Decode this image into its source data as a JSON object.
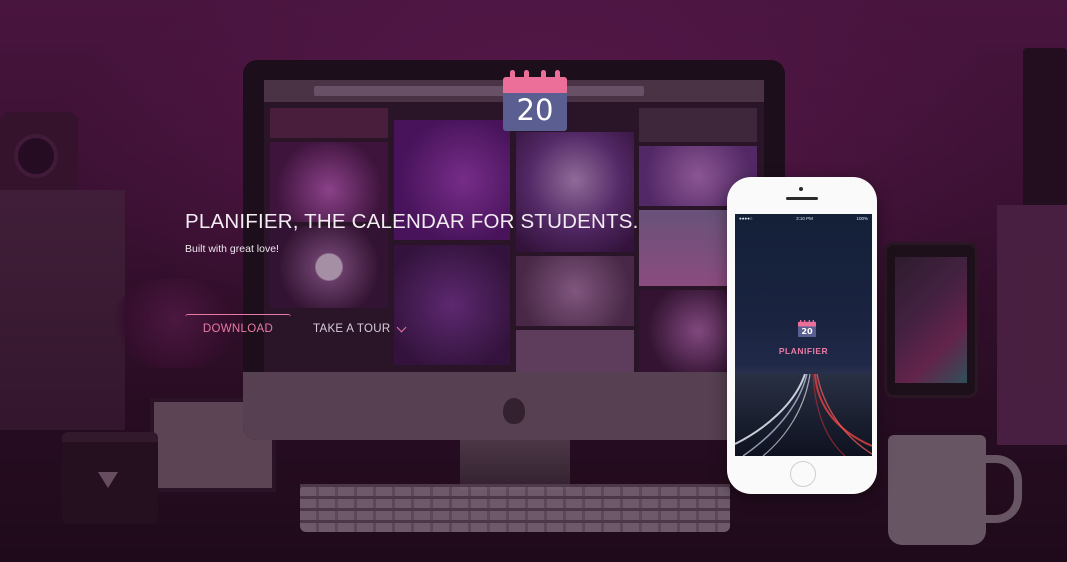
{
  "hero": {
    "title": "PLANIFIER, THE CALENDAR FOR STUDENTS.",
    "subtitle": "Built with great love!",
    "download_label": "DOWNLOAD",
    "tour_label": "TAKE A TOUR"
  },
  "logo": {
    "day": "20"
  },
  "phone": {
    "status_time": "3:10 PM",
    "status_battery": "100%",
    "logo_day": "20",
    "app_name": "PLANIFIER"
  },
  "colors": {
    "accent": "#e87ba4",
    "calendar_body": "#5a5e90",
    "calendar_header": "#ec6f99"
  },
  "icons": {
    "logo": "calendar-icon",
    "tour": "chevron-down-icon",
    "monitor_brand": "apple-icon"
  }
}
